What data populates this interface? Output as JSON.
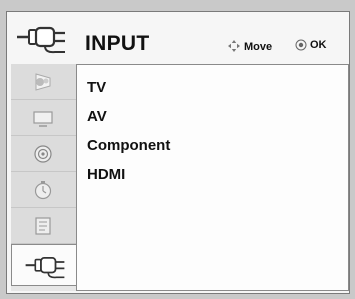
{
  "header": {
    "title": "INPUT",
    "move_label": "Move",
    "ok_label": "OK",
    "icon": "input-connector-icon"
  },
  "sidebar": {
    "items": [
      {
        "icon": "picture-icon",
        "active": false
      },
      {
        "icon": "screen-icon",
        "active": false
      },
      {
        "icon": "audio-icon",
        "active": false
      },
      {
        "icon": "time-icon",
        "active": false
      },
      {
        "icon": "option-icon",
        "active": false
      },
      {
        "icon": "input-connector-icon",
        "active": true
      }
    ]
  },
  "input_list": {
    "items": [
      "TV",
      "AV",
      "Component",
      "HDMI"
    ]
  }
}
